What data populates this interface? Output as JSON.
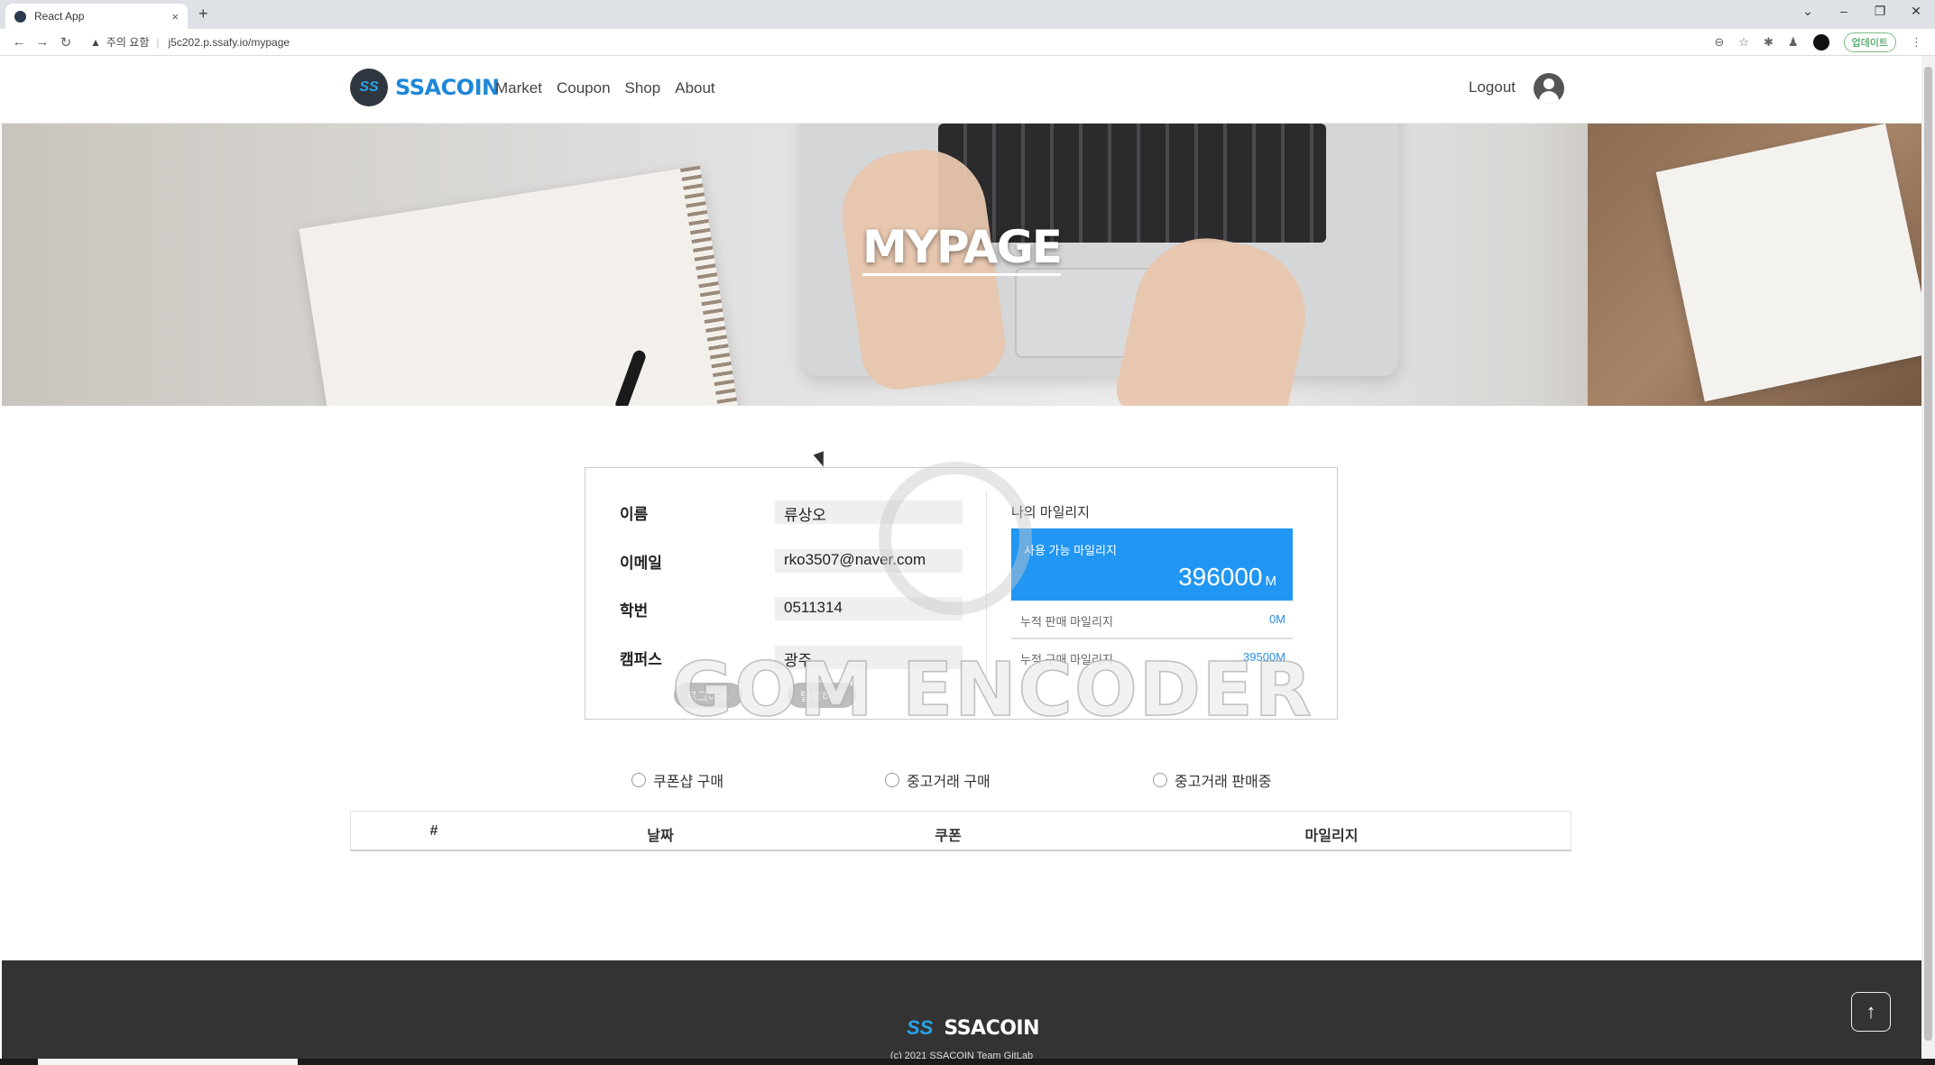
{
  "browser": {
    "tab_title": "React App",
    "tab_close": "×",
    "new_tab": "+",
    "warning": "주의 요함",
    "url": "j5c202.p.ssafy.io/mypage",
    "update_button": "업데이트"
  },
  "header": {
    "logo_badge": "SS",
    "logo_text": "SSACOIN",
    "nav": [
      "Market",
      "Coupon",
      "Shop",
      "About"
    ],
    "logout": "Logout"
  },
  "hero": {
    "title": "MYPAGE"
  },
  "profile": {
    "fields": [
      {
        "label": "이름",
        "value": "류상오"
      },
      {
        "label": "이메일",
        "value": "rko3507@naver.com"
      },
      {
        "label": "학번",
        "value": "0511314"
      },
      {
        "label": "캠퍼스",
        "value": "광주"
      }
    ],
    "buttons": {
      "logout": "로그아웃",
      "withdraw": "탈퇴하기"
    }
  },
  "mileage": {
    "title": "나의 마일리지",
    "available_label": "사용 가능 마일리지",
    "available_value": "396000",
    "unit": "M",
    "sold_label": "누적 판매 마일리지",
    "sold_value": "0M",
    "bought_label": "누적 구매 마일리지",
    "bought_value": "39500M",
    "accent_color": "#2196f3"
  },
  "watermark": "GOM ENCODER",
  "filters": [
    "쿠폰샵 구매",
    "중고거래 구매",
    "중고거래 판매중"
  ],
  "table": {
    "columns": [
      "#",
      "날짜",
      "쿠폰",
      "마일리지"
    ]
  },
  "footer": {
    "logo_badge": "SS",
    "name": "SSACOIN",
    "copyright": "(c) 2021 SSACOIN Team GitLab"
  },
  "scroll_top": "↑"
}
